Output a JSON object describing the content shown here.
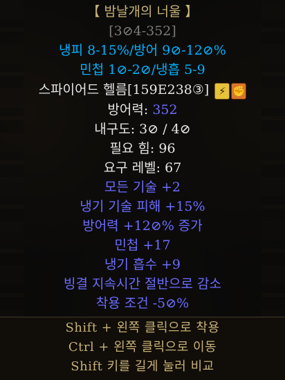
{
  "item": {
    "name": "【 밤날개의 너울 】",
    "base_range": "[3⊘4-352]",
    "magic_bonus_line1": "냉피 8-15%/방어 9⊘-12⊘%",
    "magic_bonus_line2": "민첩 1⊘-2⊘/냉흡 5-9",
    "base_type": "스파이어드 헬름[159E238③]",
    "defense_label": "방어력: ",
    "defense_value": "352",
    "durability": "내구도: 3⊘ / 4⊘",
    "req_str": "필요 힘: 96",
    "req_level": "요구 레벨: 67",
    "mods": [
      "모든 기술 +2",
      "냉기 기술 피해 +15%",
      "방어력 +12⊘% 증가",
      "민첩 +17",
      "냉기 흡수 +9",
      "빙결 지속시간 절반으로 감소",
      "착용 조건 -5⊘%"
    ]
  },
  "commands": [
    "Shift + 왼쪽 클릭으로 착용",
    "Ctrl + 왼쪽 클릭으로 이동",
    "Shift 키를 길게 눌러 비교"
  ],
  "icons": [
    "lightning-icon",
    "fist-icon"
  ],
  "colors": {
    "unique": "#c7b377",
    "magic_cyan": "#00b3ff",
    "mod_blue": "#6c6cff",
    "normal_white": "#e6e6e6",
    "gray": "#7a7a7a"
  }
}
